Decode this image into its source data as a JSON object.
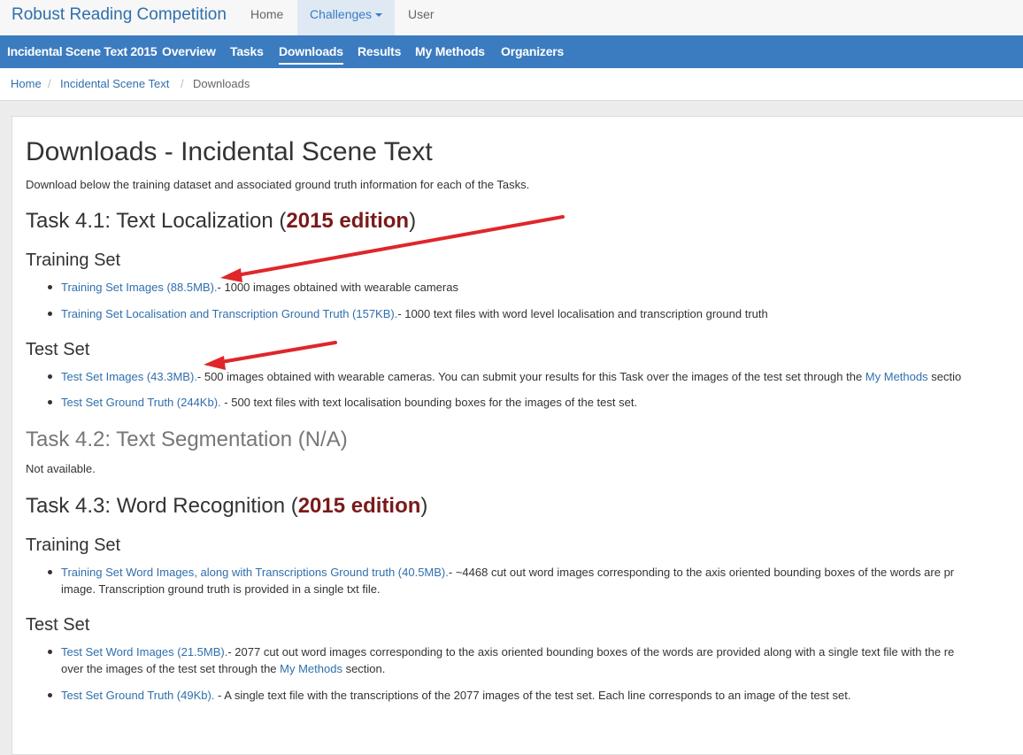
{
  "nav": {
    "brand": "Robust Reading Competition",
    "home": "Home",
    "challenges": "Challenges",
    "user": "User"
  },
  "subnav": {
    "title": "Incidental Scene Text 2015",
    "items": [
      "Overview",
      "Tasks",
      "Downloads",
      "Results",
      "My Methods",
      "Organizers"
    ],
    "active": "Downloads"
  },
  "breadcrumb": [
    "Home",
    "Incidental Scene Text",
    "Downloads"
  ],
  "page": {
    "title": "Downloads - Incidental Scene Text",
    "intro": "Download below the training dataset and associated ground truth information for each of the Tasks.",
    "task41": {
      "prefix": "Task 4.1: Text Localization (",
      "edition": "2015 edition",
      "suffix": ")",
      "training_heading": "Training Set",
      "training": [
        {
          "link": "Training Set Images (88.5MB).",
          "text": "- 1000 images obtained with wearable cameras"
        },
        {
          "link": "Training Set Localisation and Transcription Ground Truth (157KB).",
          "text": "- 1000 text files with word level localisation and transcription ground truth"
        }
      ],
      "test_heading": "Test Set",
      "test": [
        {
          "link": "Test Set Images (43.3MB).",
          "text": "- 500 images obtained with wearable cameras. You can submit your results for this Task over the images of the test set through the ",
          "link2": "My Methods",
          "text2": " sectio"
        },
        {
          "link": "Test Set Ground Truth (244Kb).",
          "text": " - 500 text files with text localisation bounding boxes for the images of the test set."
        }
      ]
    },
    "task42": {
      "title": "Task 4.2: Text Segmentation (N/A)",
      "note": "Not available."
    },
    "task43": {
      "prefix": "Task 4.3: Word Recognition (",
      "edition": "2015 edition",
      "suffix": ")",
      "training_heading": "Training Set",
      "training": [
        {
          "link": "Training Set Word Images, along with Transcriptions Ground truth (40.5MB).",
          "text": "- ~4468 cut out word images corresponding to the axis oriented bounding boxes of the words are pr",
          "line2": "image. Transcription ground truth is provided in a single txt file."
        }
      ],
      "test_heading": "Test Set",
      "test": [
        {
          "link": "Test Set Word Images (21.5MB).",
          "text": "- 2077 cut out word images corresponding to the axis oriented bounding boxes of the words are provided along with a single text file with the re",
          "line2_pre": "over the images of the test set through the ",
          "link2": "My Methods",
          "line2_post": " section."
        },
        {
          "link": "Test Set Ground Truth (49Kb).",
          "text": " - A single text file with the transcriptions of the 2077 images of the test set. Each line corresponds to an image of the test set."
        }
      ]
    }
  },
  "colors": {
    "accent": "#3b7bbf",
    "link": "#2f6fad",
    "edition": "#7a1a1a",
    "arrow": "#e0262b"
  }
}
